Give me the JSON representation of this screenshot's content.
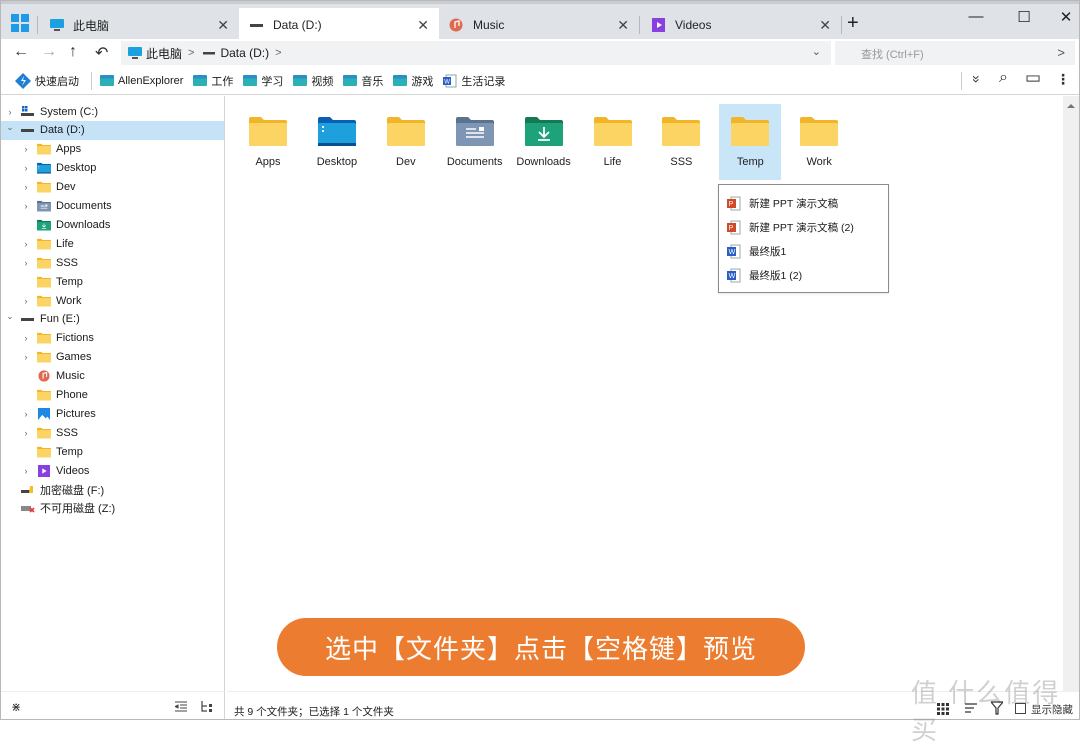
{
  "window": {
    "tabs": [
      {
        "label": "此电脑",
        "icon": "computer-icon",
        "active": false
      },
      {
        "label": "Data (D:)",
        "icon": "drive-icon",
        "active": true
      },
      {
        "label": "Music",
        "icon": "music-icon",
        "active": false
      },
      {
        "label": "Videos",
        "icon": "videos-icon",
        "active": false
      }
    ],
    "tab_close": "✕",
    "new_tab": "+",
    "minimize": "—",
    "maximize": "☐",
    "close": "✕"
  },
  "nav": {
    "back": "←",
    "forward": "→",
    "up": "↑",
    "undo": "↶",
    "breadcrumb": [
      {
        "label": "此电脑"
      },
      {
        "label": "Data (D:)"
      }
    ],
    "crumb_sep": ">",
    "dropdown": "⌄",
    "search_placeholder": "查找 (Ctrl+F)",
    "search_go": ">"
  },
  "bookmarks": {
    "quick_launch": "快速启动",
    "items": [
      "AllenExplorer",
      "工作",
      "学习",
      "视频",
      "音乐",
      "游戏"
    ],
    "doc_item": "生活记录",
    "tools": {
      "expand": "»",
      "search": "⌕",
      "layout": "▭",
      "more": "⋮"
    }
  },
  "sidebar": {
    "items": [
      {
        "label": "System (C:)",
        "level": 0,
        "expander": ">",
        "icon": "system-drive-icon"
      },
      {
        "label": "Data (D:)",
        "level": 0,
        "expander": "v",
        "icon": "drive-icon",
        "selected": true
      },
      {
        "label": "Apps",
        "level": 1,
        "expander": ">",
        "icon": "folder-icon"
      },
      {
        "label": "Desktop",
        "level": 1,
        "expander": ">",
        "icon": "desktop-folder-icon"
      },
      {
        "label": "Dev",
        "level": 1,
        "expander": ">",
        "icon": "folder-icon"
      },
      {
        "label": "Documents",
        "level": 1,
        "expander": ">",
        "icon": "documents-icon"
      },
      {
        "label": "Downloads",
        "level": 1,
        "expander": "",
        "icon": "downloads-icon"
      },
      {
        "label": "Life",
        "level": 1,
        "expander": ">",
        "icon": "folder-icon"
      },
      {
        "label": "SSS",
        "level": 1,
        "expander": ">",
        "icon": "folder-icon"
      },
      {
        "label": "Temp",
        "level": 1,
        "expander": "",
        "icon": "folder-icon"
      },
      {
        "label": "Work",
        "level": 1,
        "expander": ">",
        "icon": "folder-icon"
      },
      {
        "label": "Fun (E:)",
        "level": 0,
        "expander": "v",
        "icon": "drive-icon"
      },
      {
        "label": "Fictions",
        "level": 1,
        "expander": ">",
        "icon": "folder-icon"
      },
      {
        "label": "Games",
        "level": 1,
        "expander": ">",
        "icon": "folder-icon"
      },
      {
        "label": "Music",
        "level": 1,
        "expander": "",
        "icon": "music-icon"
      },
      {
        "label": "Phone",
        "level": 1,
        "expander": "",
        "icon": "folder-icon"
      },
      {
        "label": "Pictures",
        "level": 1,
        "expander": ">",
        "icon": "pictures-icon"
      },
      {
        "label": "SSS",
        "level": 1,
        "expander": ">",
        "icon": "folder-icon"
      },
      {
        "label": "Temp",
        "level": 1,
        "expander": "",
        "icon": "folder-icon"
      },
      {
        "label": "Videos",
        "level": 1,
        "expander": ">",
        "icon": "videos-icon"
      },
      {
        "label": "加密磁盘 (F:)",
        "level": 0,
        "expander": "",
        "icon": "encrypted-drive-icon"
      },
      {
        "label": "不可用磁盘 (Z:)",
        "level": 0,
        "expander": "",
        "icon": "unavailable-drive-icon"
      }
    ]
  },
  "main": {
    "folders": [
      {
        "label": "Apps",
        "icon": "folder-icon"
      },
      {
        "label": "Desktop",
        "icon": "desktop-folder-icon"
      },
      {
        "label": "Dev",
        "icon": "folder-icon"
      },
      {
        "label": "Documents",
        "icon": "documents-icon"
      },
      {
        "label": "Downloads",
        "icon": "downloads-icon"
      },
      {
        "label": "Life",
        "icon": "folder-icon"
      },
      {
        "label": "SSS",
        "icon": "folder-icon"
      },
      {
        "label": "Temp",
        "icon": "folder-icon",
        "selected": true
      },
      {
        "label": "Work",
        "icon": "folder-icon"
      }
    ],
    "preview": [
      {
        "label": "新建 PPT 演示文稿",
        "type": "ppt"
      },
      {
        "label": "新建 PPT 演示文稿 (2)",
        "type": "ppt"
      },
      {
        "label": "最终版1",
        "type": "word"
      },
      {
        "label": "最终版1 (2)",
        "type": "word"
      }
    ]
  },
  "banner": {
    "text": "选中【文件夹】点击【空格键】预览"
  },
  "status": {
    "text": "共 9 个文件夹；已选择 1 个文件夹",
    "collapse": "⋇",
    "show_hidden": "显示隐藏"
  },
  "watermark": "值 什么值得买",
  "colors": {
    "accent": "#1e9be6",
    "selection": "#c6e2f7",
    "folder": "#f9c948",
    "banner": "#ec7c2f"
  }
}
